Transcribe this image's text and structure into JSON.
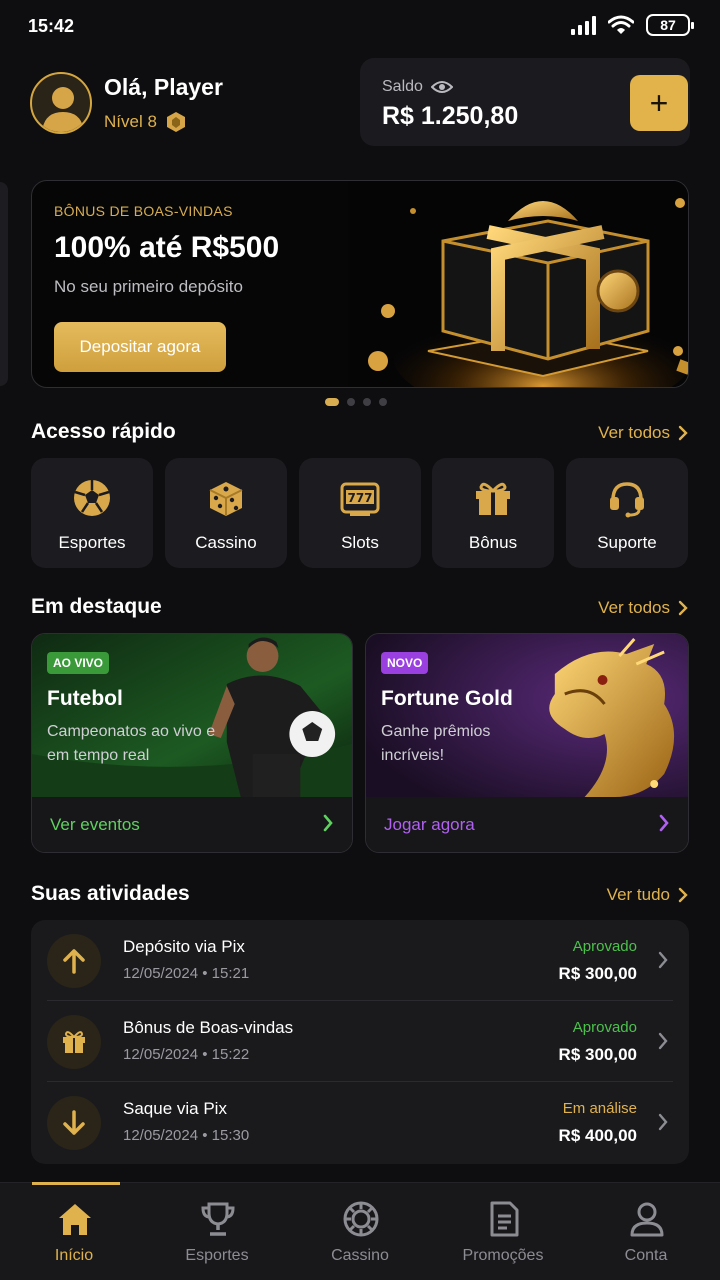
{
  "status_bar": {
    "time": "15:42",
    "battery": "87"
  },
  "header": {
    "greeting": "Olá, Player",
    "level": "Nível 8",
    "balance_label": "Saldo",
    "balance_value": "R$ 1.250,80",
    "add_label": "+"
  },
  "banner": {
    "kicker": "BÔNUS DE BOAS-VINDAS",
    "title": "100% até R$500",
    "subtitle": "No seu primeiro depósito",
    "cta": "Depositar agora",
    "slides": 4,
    "active_slide": 1
  },
  "quick_access": {
    "title": "Acesso rápido",
    "see_all": "Ver todos",
    "items": [
      {
        "label": "Esportes",
        "icon": "soccer-ball-icon"
      },
      {
        "label": "Cassino",
        "icon": "dice-icon"
      },
      {
        "label": "Slots",
        "icon": "slot-machine-icon"
      },
      {
        "label": "Bônus",
        "icon": "gift-icon"
      },
      {
        "label": "Suporte",
        "icon": "headset-icon"
      }
    ]
  },
  "featured": {
    "title": "Em destaque",
    "see_all": "Ver todos",
    "cards": [
      {
        "badge": "AO VIVO",
        "title": "Futebol",
        "description": "Campeonatos ao vivo e em tempo real",
        "link": "Ver eventos",
        "accent": "#5fd15f"
      },
      {
        "badge": "NOVO",
        "title": "Fortune Gold",
        "description": "Ganhe prêmios incríveis!",
        "link": "Jogar agora",
        "accent": "#b061f0"
      }
    ]
  },
  "activities": {
    "title": "Suas atividades",
    "see_all": "Ver tudo",
    "items": [
      {
        "title": "Depósito via Pix",
        "date": "12/05/2024",
        "time": "15:21",
        "status": "Aprovado",
        "amount": "R$ 300,00",
        "icon": "arrow-up-icon"
      },
      {
        "title": "Bônus de Boas-vindas",
        "date": "12/05/2024",
        "time": "15:22",
        "status": "Aprovado",
        "amount": "R$ 300,00",
        "icon": "gift-icon"
      },
      {
        "title": "Saque via Pix",
        "date": "12/05/2024",
        "time": "15:30",
        "status": "Em análise",
        "amount": "R$ 400,00",
        "icon": "arrow-down-icon"
      }
    ]
  },
  "tabbar": {
    "items": [
      {
        "label": "Início",
        "icon": "home-icon",
        "active": true
      },
      {
        "label": "Esportes",
        "icon": "trophy-icon",
        "active": false
      },
      {
        "label": "Cassino",
        "icon": "casino-chip-icon",
        "active": false
      },
      {
        "label": "Promoções",
        "icon": "promo-document-icon",
        "active": false
      },
      {
        "label": "Conta",
        "icon": "user-icon",
        "active": false
      }
    ]
  },
  "colors": {
    "gold": "#e0b24e",
    "approved": "#4cc24c",
    "pending": "#e0b24e",
    "background": "#0e0e10"
  }
}
